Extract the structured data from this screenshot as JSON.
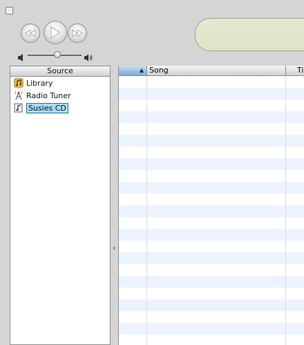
{
  "window": {
    "corner_icon": "window-zoom-icon"
  },
  "transport": {
    "prev_icon": "rewind-icon",
    "play_icon": "play-icon",
    "next_icon": "fast-forward-icon"
  },
  "volume": {
    "level": 0.55,
    "low_icon": "speaker-low-icon",
    "high_icon": "speaker-high-icon"
  },
  "source": {
    "header": "Source",
    "items": [
      {
        "label": "Library",
        "icon": "library-icon",
        "selected": false
      },
      {
        "label": "Radio Tuner",
        "icon": "radio-tower-icon",
        "selected": false
      },
      {
        "label": "Susies CD",
        "icon": "cd-icon",
        "selected": true
      }
    ]
  },
  "songs": {
    "columns": [
      {
        "label": "",
        "sort_icon": "sort-ascending-icon"
      },
      {
        "label": "Song"
      },
      {
        "label": "Ti"
      }
    ]
  },
  "colors": {
    "lcd": "#e2e7cb",
    "selected": "#a6dcf7",
    "stripe": "#edf3fe",
    "sort_column": "#8fb5dd"
  }
}
